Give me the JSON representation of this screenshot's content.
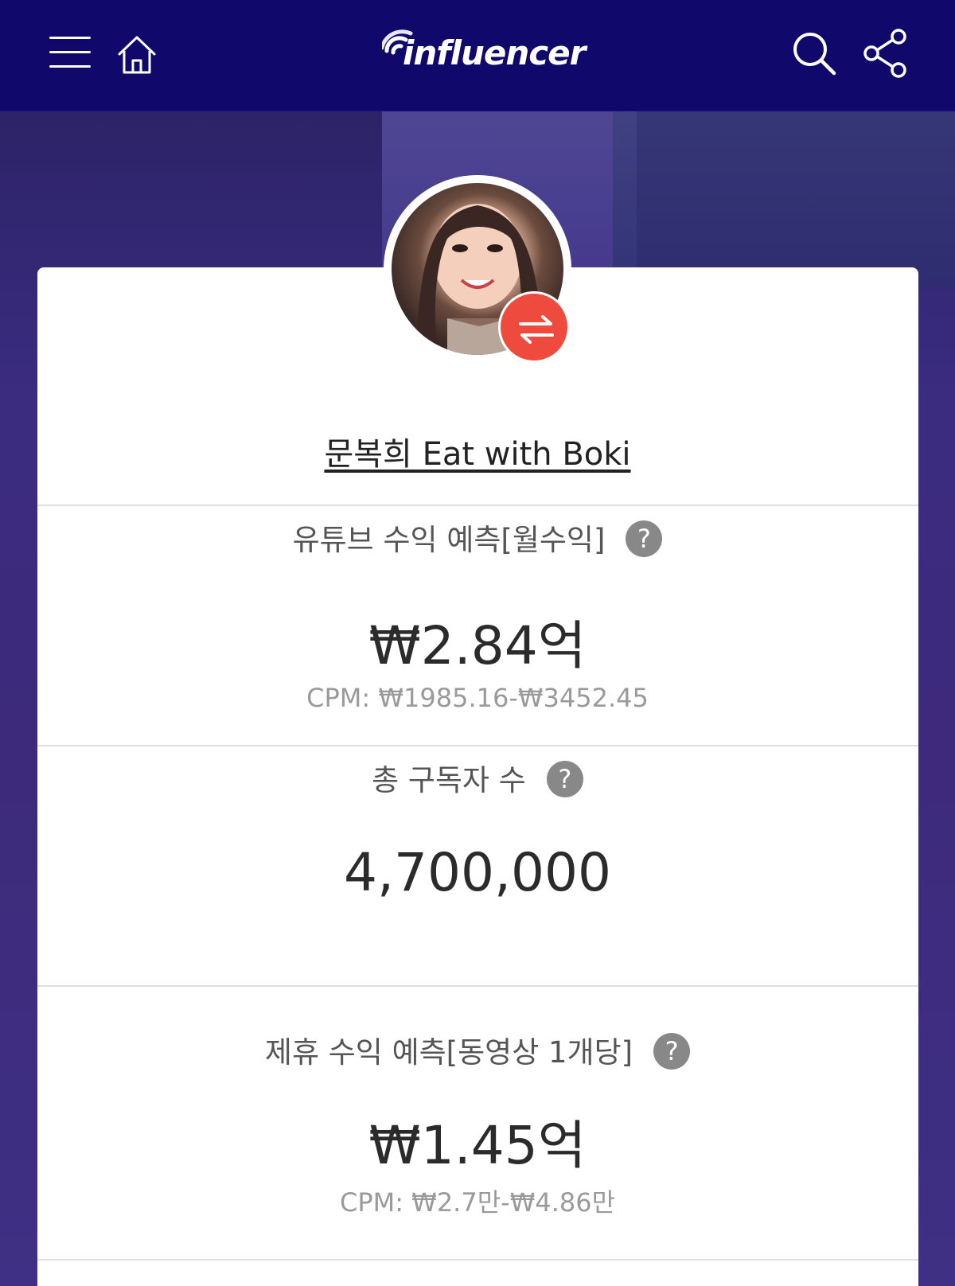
{
  "header": {
    "logo_text": "influencer",
    "icons": [
      "menu-icon",
      "home-icon",
      "search-icon",
      "share-icon"
    ]
  },
  "profile": {
    "name": "문복희 Eat with Boki",
    "badge_icon": "swap-icon"
  },
  "stats": [
    {
      "label": "유튜브 수익 예측[월수익]",
      "help": "?",
      "value": "₩2.84억",
      "cpm": "CPM: ₩1985.16-₩3452.45"
    },
    {
      "label": "총 구독자 수",
      "help": "?",
      "value": "4,700,000"
    },
    {
      "label": "제휴 수익 예측[동영상 1개당]",
      "help": "?",
      "value": "₩1.45억",
      "cpm": "CPM: ₩2.7만-₩4.86만"
    }
  ],
  "colors": {
    "header_bg": "#11086b",
    "badge": "#ee4a3d",
    "help_icon": "#888888"
  }
}
